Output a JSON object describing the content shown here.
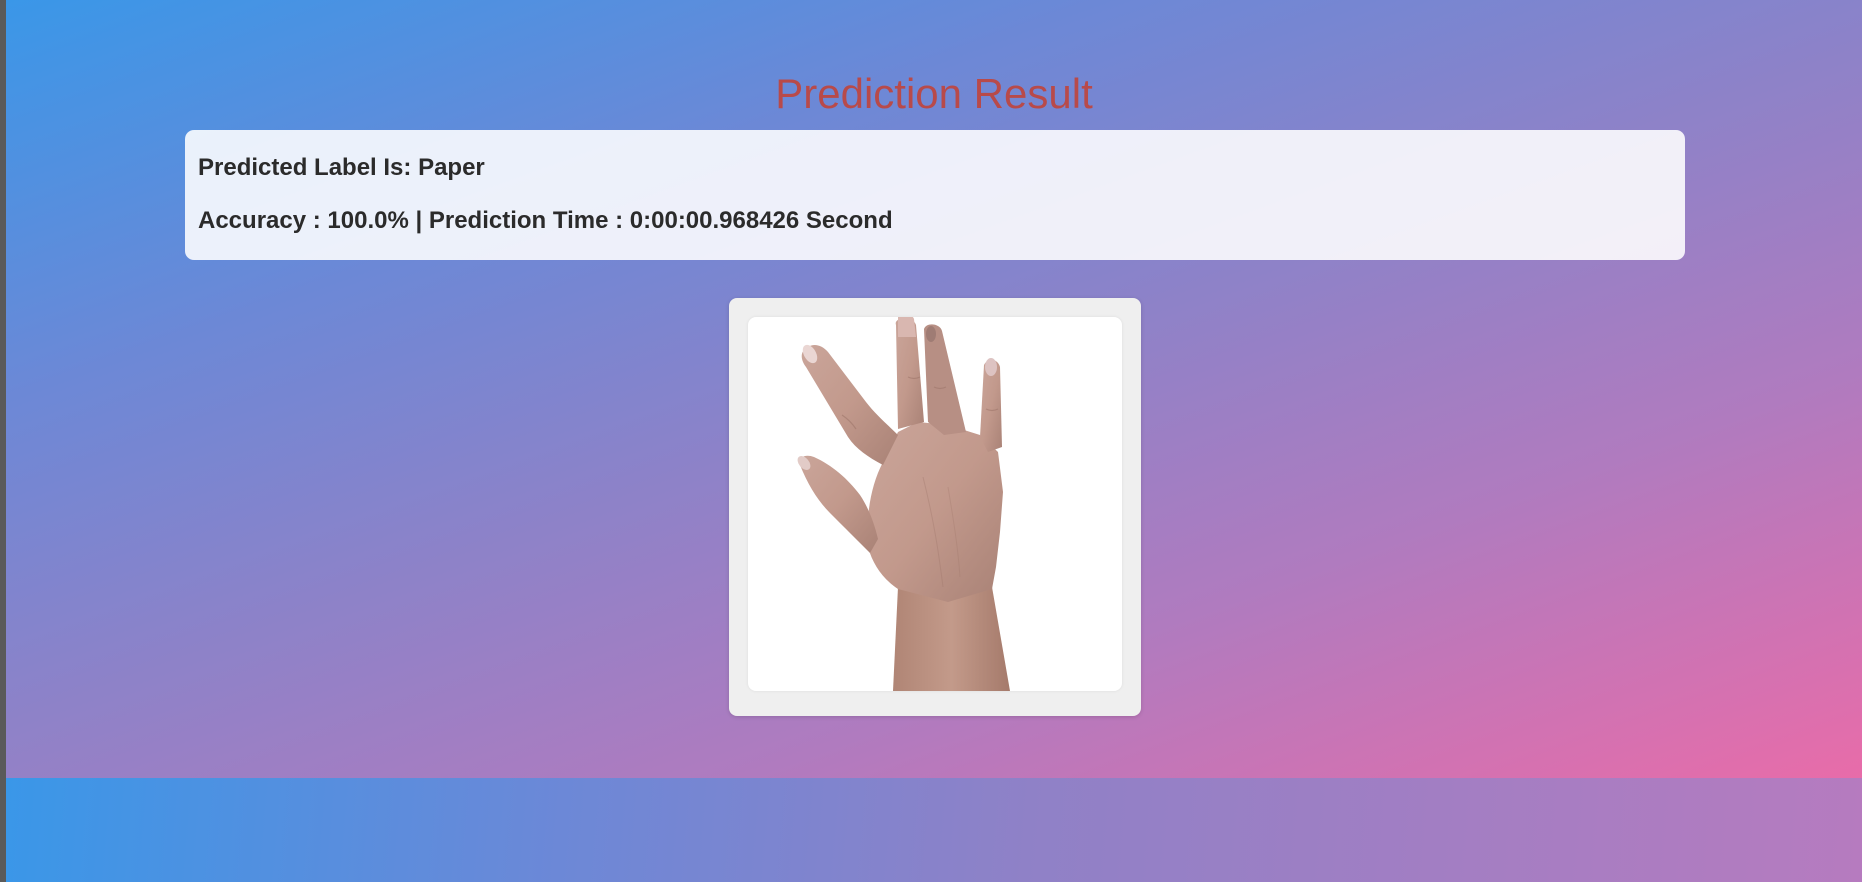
{
  "page": {
    "title": "Prediction Result"
  },
  "result": {
    "label_text": "Predicted Label Is: Paper",
    "metrics_text": "Accuracy : 100.0% | Prediction Time : 0:00:00.968426 Second"
  },
  "image": {
    "subject": "open-hand-paper-gesture"
  },
  "colors": {
    "title": "#b84a4a",
    "gradient_start": "#3a97e8",
    "gradient_end": "#e86ca9"
  }
}
